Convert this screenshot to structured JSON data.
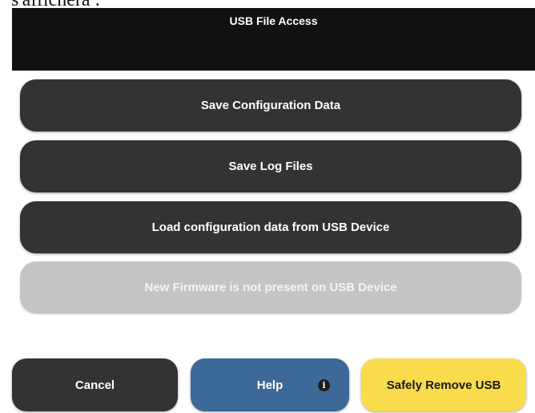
{
  "stray_text": "s'affichera :",
  "header": {
    "title": "USB File Access"
  },
  "menu": {
    "items": [
      {
        "label": "Save Configuration Data",
        "enabled": true
      },
      {
        "label": "Save Log Files",
        "enabled": true
      },
      {
        "label": "Load configuration data from USB Device",
        "enabled": true
      },
      {
        "label": "New Firmware is not present on USB Device",
        "enabled": false
      }
    ]
  },
  "footer": {
    "cancel_label": "Cancel",
    "help_label": "Help",
    "help_icon": "info-icon",
    "remove_label": "Safely Remove USB"
  },
  "colors": {
    "header_bg": "#111111",
    "button_bg": "#333333",
    "disabled_bg": "#c4c4c4",
    "help_bg": "#3d6999",
    "remove_bg": "#f8dc4c"
  }
}
